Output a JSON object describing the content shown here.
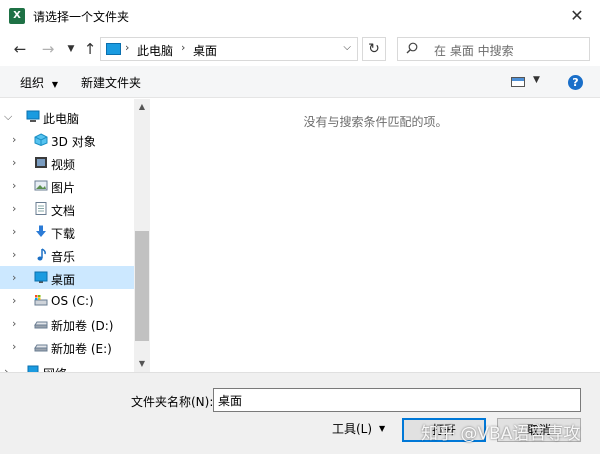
{
  "window": {
    "title": "请选择一个文件夹",
    "app_icon": "X"
  },
  "nav": {
    "address": [
      "此电脑",
      "桌面"
    ],
    "search_placeholder": "在 桌面 中搜索"
  },
  "toolbar": {
    "organize": "组织",
    "new_folder": "新建文件夹"
  },
  "tree": {
    "items": [
      {
        "label": "此电脑",
        "icon": "pc-icon"
      },
      {
        "label": "3D 对象",
        "icon": "cube-icon"
      },
      {
        "label": "视频",
        "icon": "video-icon"
      },
      {
        "label": "图片",
        "icon": "picture-icon"
      },
      {
        "label": "文档",
        "icon": "document-icon"
      },
      {
        "label": "下载",
        "icon": "download-icon"
      },
      {
        "label": "音乐",
        "icon": "music-icon"
      },
      {
        "label": "桌面",
        "icon": "desktop-icon"
      },
      {
        "label": "OS (C:)",
        "icon": "drive-c-icon"
      },
      {
        "label": "新加卷 (D:)",
        "icon": "drive-icon"
      },
      {
        "label": "新加卷 (E:)",
        "icon": "drive-icon"
      },
      {
        "label": "网络",
        "icon": "network-icon"
      }
    ]
  },
  "content": {
    "empty_message": "没有与搜索条件匹配的项。"
  },
  "bottom": {
    "folder_name_label": "文件夹名称(N):",
    "folder_name_value": "桌面",
    "tools_label": "工具(L)",
    "open_label": "打开",
    "cancel_label": "取消"
  },
  "watermark": "知乎 @VBA语言専攻",
  "colors": {
    "selected": "#cce8ff",
    "accent": "#0078d7",
    "excel_green": "#1e7145"
  }
}
